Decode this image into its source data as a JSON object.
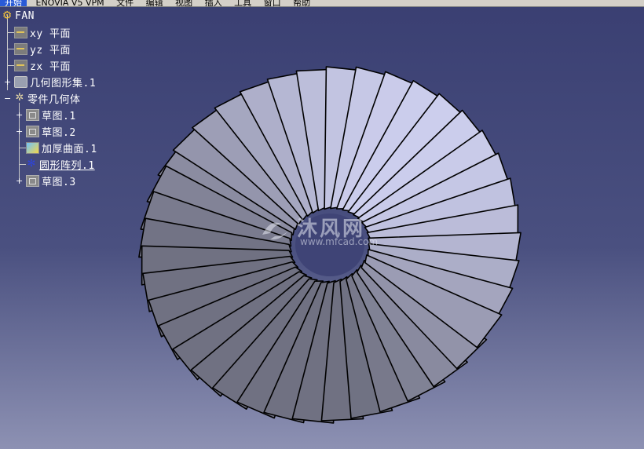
{
  "menubar": {
    "start_label": "开始",
    "items": [
      "ENOVIA V5 VPM",
      "文件",
      "编辑",
      "视图",
      "插入",
      "工具",
      "窗口",
      "帮助"
    ]
  },
  "tree": {
    "root": "FAN",
    "xy_plane": "xy 平面",
    "yz_plane": "yz 平面",
    "zx_plane": "zx 平面",
    "geometrical_set": "几何图形集.1",
    "part_body": "零件几何体",
    "sketch1": "草图.1",
    "sketch2": "草图.2",
    "thick_surface": "加厚曲面.1",
    "circular_pattern": "圆形阵列.1",
    "sketch3": "草图.3"
  },
  "watermark": {
    "name": "沐风网",
    "url": "www.mfcad.com"
  },
  "model": {
    "blade_count": 40,
    "blade_color": "#ccceed",
    "edge_color": "#000000"
  },
  "colors": {
    "background_top": "#3a3f72",
    "background_bottom": "#8d91b3",
    "tree_text": "#ffffff"
  }
}
